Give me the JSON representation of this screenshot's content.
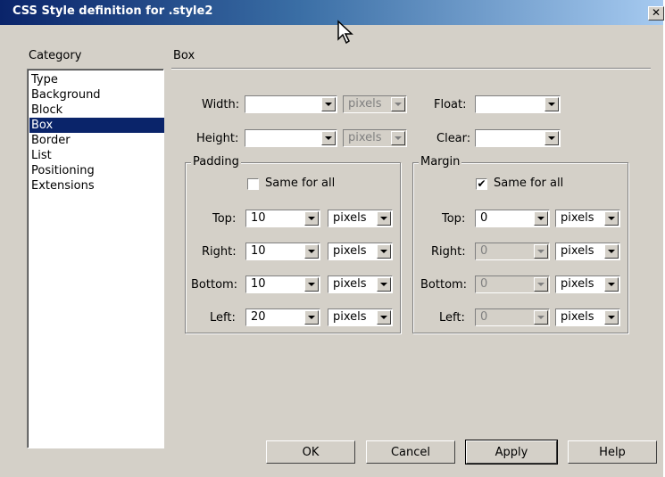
{
  "window": {
    "title": "CSS Style definition for .style2",
    "close_symbol": "✕"
  },
  "category": {
    "heading": "Category",
    "items": [
      "Type",
      "Background",
      "Block",
      "Box",
      "Border",
      "List",
      "Positioning",
      "Extensions"
    ],
    "selected": "Box"
  },
  "panel": {
    "heading": "Box",
    "width": {
      "label": "Width:",
      "value": "",
      "unit": "pixels"
    },
    "height": {
      "label": "Height:",
      "value": "",
      "unit": "pixels"
    },
    "float": {
      "label": "Float:",
      "value": ""
    },
    "clear": {
      "label": "Clear:",
      "value": ""
    }
  },
  "padding": {
    "title": "Padding",
    "same_for_all": {
      "label": "Same for all",
      "checked": false,
      "mark": ""
    },
    "top": {
      "label": "Top:",
      "value": "10",
      "unit": "pixels"
    },
    "right": {
      "label": "Right:",
      "value": "10",
      "unit": "pixels"
    },
    "bottom": {
      "label": "Bottom:",
      "value": "10",
      "unit": "pixels"
    },
    "left": {
      "label": "Left:",
      "value": "20",
      "unit": "pixels"
    }
  },
  "margin": {
    "title": "Margin",
    "same_for_all": {
      "label": "Same for all",
      "checked": true,
      "mark": "✔"
    },
    "top": {
      "label": "Top:",
      "value": "0",
      "unit": "pixels"
    },
    "right": {
      "label": "Right:",
      "value": "0",
      "unit": "pixels"
    },
    "bottom": {
      "label": "Bottom:",
      "value": "0",
      "unit": "pixels"
    },
    "left": {
      "label": "Left:",
      "value": "0",
      "unit": "pixels"
    }
  },
  "buttons": {
    "ok": "OK",
    "cancel": "Cancel",
    "apply": "Apply",
    "help": "Help"
  },
  "colors": {
    "title_gradient_start": "#0a246a",
    "title_gradient_end": "#a6caf0",
    "selection": "#0a246a",
    "face": "#d4d0c8"
  }
}
